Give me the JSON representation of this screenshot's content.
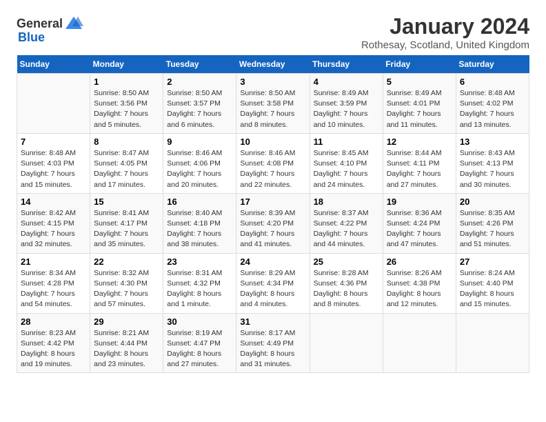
{
  "header": {
    "logo_general": "General",
    "logo_blue": "Blue",
    "title": "January 2024",
    "subtitle": "Rothesay, Scotland, United Kingdom"
  },
  "columns": [
    "Sunday",
    "Monday",
    "Tuesday",
    "Wednesday",
    "Thursday",
    "Friday",
    "Saturday"
  ],
  "weeks": [
    [
      {
        "day": "",
        "info": ""
      },
      {
        "day": "1",
        "info": "Sunrise: 8:50 AM\nSunset: 3:56 PM\nDaylight: 7 hours\nand 5 minutes."
      },
      {
        "day": "2",
        "info": "Sunrise: 8:50 AM\nSunset: 3:57 PM\nDaylight: 7 hours\nand 6 minutes."
      },
      {
        "day": "3",
        "info": "Sunrise: 8:50 AM\nSunset: 3:58 PM\nDaylight: 7 hours\nand 8 minutes."
      },
      {
        "day": "4",
        "info": "Sunrise: 8:49 AM\nSunset: 3:59 PM\nDaylight: 7 hours\nand 10 minutes."
      },
      {
        "day": "5",
        "info": "Sunrise: 8:49 AM\nSunset: 4:01 PM\nDaylight: 7 hours\nand 11 minutes."
      },
      {
        "day": "6",
        "info": "Sunrise: 8:48 AM\nSunset: 4:02 PM\nDaylight: 7 hours\nand 13 minutes."
      }
    ],
    [
      {
        "day": "7",
        "info": "Sunrise: 8:48 AM\nSunset: 4:03 PM\nDaylight: 7 hours\nand 15 minutes."
      },
      {
        "day": "8",
        "info": "Sunrise: 8:47 AM\nSunset: 4:05 PM\nDaylight: 7 hours\nand 17 minutes."
      },
      {
        "day": "9",
        "info": "Sunrise: 8:46 AM\nSunset: 4:06 PM\nDaylight: 7 hours\nand 20 minutes."
      },
      {
        "day": "10",
        "info": "Sunrise: 8:46 AM\nSunset: 4:08 PM\nDaylight: 7 hours\nand 22 minutes."
      },
      {
        "day": "11",
        "info": "Sunrise: 8:45 AM\nSunset: 4:10 PM\nDaylight: 7 hours\nand 24 minutes."
      },
      {
        "day": "12",
        "info": "Sunrise: 8:44 AM\nSunset: 4:11 PM\nDaylight: 7 hours\nand 27 minutes."
      },
      {
        "day": "13",
        "info": "Sunrise: 8:43 AM\nSunset: 4:13 PM\nDaylight: 7 hours\nand 30 minutes."
      }
    ],
    [
      {
        "day": "14",
        "info": "Sunrise: 8:42 AM\nSunset: 4:15 PM\nDaylight: 7 hours\nand 32 minutes."
      },
      {
        "day": "15",
        "info": "Sunrise: 8:41 AM\nSunset: 4:17 PM\nDaylight: 7 hours\nand 35 minutes."
      },
      {
        "day": "16",
        "info": "Sunrise: 8:40 AM\nSunset: 4:18 PM\nDaylight: 7 hours\nand 38 minutes."
      },
      {
        "day": "17",
        "info": "Sunrise: 8:39 AM\nSunset: 4:20 PM\nDaylight: 7 hours\nand 41 minutes."
      },
      {
        "day": "18",
        "info": "Sunrise: 8:37 AM\nSunset: 4:22 PM\nDaylight: 7 hours\nand 44 minutes."
      },
      {
        "day": "19",
        "info": "Sunrise: 8:36 AM\nSunset: 4:24 PM\nDaylight: 7 hours\nand 47 minutes."
      },
      {
        "day": "20",
        "info": "Sunrise: 8:35 AM\nSunset: 4:26 PM\nDaylight: 7 hours\nand 51 minutes."
      }
    ],
    [
      {
        "day": "21",
        "info": "Sunrise: 8:34 AM\nSunset: 4:28 PM\nDaylight: 7 hours\nand 54 minutes."
      },
      {
        "day": "22",
        "info": "Sunrise: 8:32 AM\nSunset: 4:30 PM\nDaylight: 7 hours\nand 57 minutes."
      },
      {
        "day": "23",
        "info": "Sunrise: 8:31 AM\nSunset: 4:32 PM\nDaylight: 8 hours\nand 1 minute."
      },
      {
        "day": "24",
        "info": "Sunrise: 8:29 AM\nSunset: 4:34 PM\nDaylight: 8 hours\nand 4 minutes."
      },
      {
        "day": "25",
        "info": "Sunrise: 8:28 AM\nSunset: 4:36 PM\nDaylight: 8 hours\nand 8 minutes."
      },
      {
        "day": "26",
        "info": "Sunrise: 8:26 AM\nSunset: 4:38 PM\nDaylight: 8 hours\nand 12 minutes."
      },
      {
        "day": "27",
        "info": "Sunrise: 8:24 AM\nSunset: 4:40 PM\nDaylight: 8 hours\nand 15 minutes."
      }
    ],
    [
      {
        "day": "28",
        "info": "Sunrise: 8:23 AM\nSunset: 4:42 PM\nDaylight: 8 hours\nand 19 minutes."
      },
      {
        "day": "29",
        "info": "Sunrise: 8:21 AM\nSunset: 4:44 PM\nDaylight: 8 hours\nand 23 minutes."
      },
      {
        "day": "30",
        "info": "Sunrise: 8:19 AM\nSunset: 4:47 PM\nDaylight: 8 hours\nand 27 minutes."
      },
      {
        "day": "31",
        "info": "Sunrise: 8:17 AM\nSunset: 4:49 PM\nDaylight: 8 hours\nand 31 minutes."
      },
      {
        "day": "",
        "info": ""
      },
      {
        "day": "",
        "info": ""
      },
      {
        "day": "",
        "info": ""
      }
    ]
  ]
}
